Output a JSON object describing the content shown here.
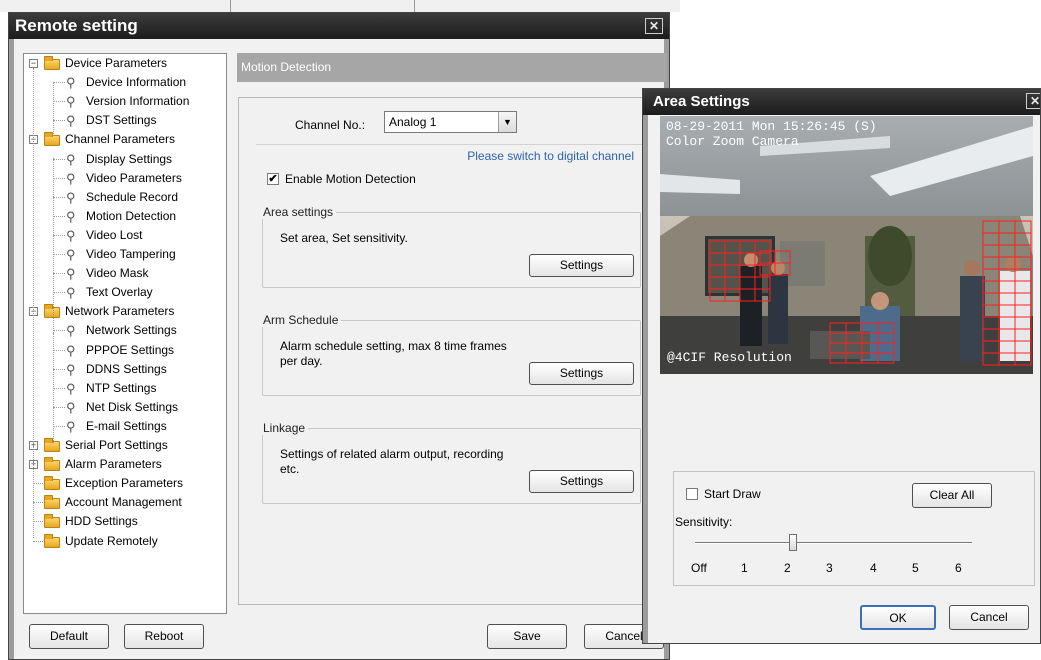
{
  "remote": {
    "title": "Remote setting",
    "tree": [
      {
        "label": "Device Parameters",
        "kind": "folder",
        "level": 0,
        "expander": "−"
      },
      {
        "label": "Device Information",
        "kind": "leaf",
        "level": 1
      },
      {
        "label": "Version Information",
        "kind": "leaf",
        "level": 1
      },
      {
        "label": "DST Settings",
        "kind": "leaf",
        "level": 1
      },
      {
        "label": "Channel Parameters",
        "kind": "folder",
        "level": 0,
        "expander": "−"
      },
      {
        "label": "Display Settings",
        "kind": "leaf",
        "level": 1
      },
      {
        "label": "Video Parameters",
        "kind": "leaf",
        "level": 1
      },
      {
        "label": "Schedule Record",
        "kind": "leaf",
        "level": 1
      },
      {
        "label": "Motion Detection",
        "kind": "leaf",
        "level": 1
      },
      {
        "label": "Video Lost",
        "kind": "leaf",
        "level": 1
      },
      {
        "label": "Video Tampering",
        "kind": "leaf",
        "level": 1
      },
      {
        "label": "Video Mask",
        "kind": "leaf",
        "level": 1
      },
      {
        "label": "Text Overlay",
        "kind": "leaf",
        "level": 1
      },
      {
        "label": "Network Parameters",
        "kind": "folder",
        "level": 0,
        "expander": "−"
      },
      {
        "label": "Network Settings",
        "kind": "leaf",
        "level": 1
      },
      {
        "label": "PPPOE Settings",
        "kind": "leaf",
        "level": 1
      },
      {
        "label": "DDNS Settings",
        "kind": "leaf",
        "level": 1
      },
      {
        "label": "NTP Settings",
        "kind": "leaf",
        "level": 1
      },
      {
        "label": "Net Disk Settings",
        "kind": "leaf",
        "level": 1
      },
      {
        "label": "E-mail Settings",
        "kind": "leaf",
        "level": 1
      },
      {
        "label": "Serial Port Settings",
        "kind": "folder",
        "level": 0,
        "expander": "+"
      },
      {
        "label": "Alarm Parameters",
        "kind": "folder",
        "level": 0,
        "expander": "+"
      },
      {
        "label": "Exception Parameters",
        "kind": "folder",
        "level": 0,
        "expander": ""
      },
      {
        "label": "Account Management",
        "kind": "folder",
        "level": 0,
        "expander": ""
      },
      {
        "label": "HDD Settings",
        "kind": "folder",
        "level": 0,
        "expander": ""
      },
      {
        "label": "Update Remotely",
        "kind": "folder",
        "level": 0,
        "expander": ""
      }
    ],
    "panel": {
      "header": "Motion Detection",
      "channel_label": "Channel No.:",
      "channel_value": "Analog 1",
      "switch_text": "Please switch to digital channel",
      "enable_label": "Enable Motion Detection",
      "enable_checked": "✔",
      "groups": [
        {
          "title": "Area settings",
          "text": "Set area, Set sensitivity.",
          "button": "Settings"
        },
        {
          "title": "Arm Schedule",
          "text": "Alarm schedule setting, max 8 time frames per day.",
          "button": "Settings"
        },
        {
          "title": "Linkage",
          "text": "Settings of related alarm output, recording etc.",
          "button": "Settings"
        }
      ]
    },
    "buttons": {
      "default": "Default",
      "reboot": "Reboot",
      "save": "Save",
      "cancel": "Cancel"
    }
  },
  "area": {
    "title": "Area Settings",
    "osd_date": "08-29-2011 Mon 15:26:45 (S)",
    "osd_camera": "Color Zoom Camera",
    "osd_resolution": "@4CIF Resolution",
    "start_draw_label": "Start Draw",
    "clear_all": "Clear All",
    "sensitivity_label": "Sensitivity:",
    "sensitivity_value": 2,
    "sensitivity_ticks": [
      "Off",
      "1",
      "2",
      "3",
      "4",
      "5",
      "6"
    ],
    "ok": "OK",
    "cancel": "Cancel"
  },
  "colors": {
    "link": "#2e62b0",
    "grid": "#ff2020",
    "titlebar": "#1f1f1f"
  }
}
